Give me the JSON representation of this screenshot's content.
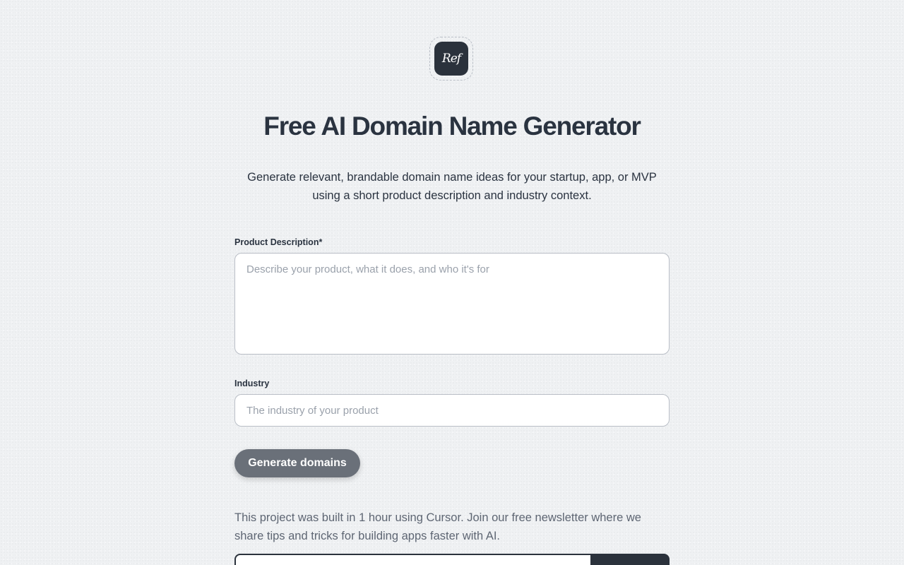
{
  "logo": {
    "text": "Ref"
  },
  "page": {
    "title": "Free AI Domain Name Generator",
    "subtitle": "Generate relevant, brandable domain name ideas for your startup, app, or MVP using a short product description and industry context."
  },
  "form": {
    "description_label": "Product Description*",
    "description_placeholder": "Describe your product, what it does, and who it's for",
    "description_value": "",
    "industry_label": "Industry",
    "industry_placeholder": "The industry of your product",
    "industry_value": "",
    "generate_label": "Generate domains"
  },
  "newsletter": {
    "text": "This project was built in 1 hour using Cursor. Join our free newsletter where we share tips and tricks for building apps faster with AI.",
    "email_value": "",
    "button_label": ""
  },
  "colors": {
    "background": "#eff1f3",
    "text_primary": "#2a3340",
    "text_muted": "#5e6673",
    "button_disabled": "#6a7079",
    "dark": "#2b323c"
  }
}
